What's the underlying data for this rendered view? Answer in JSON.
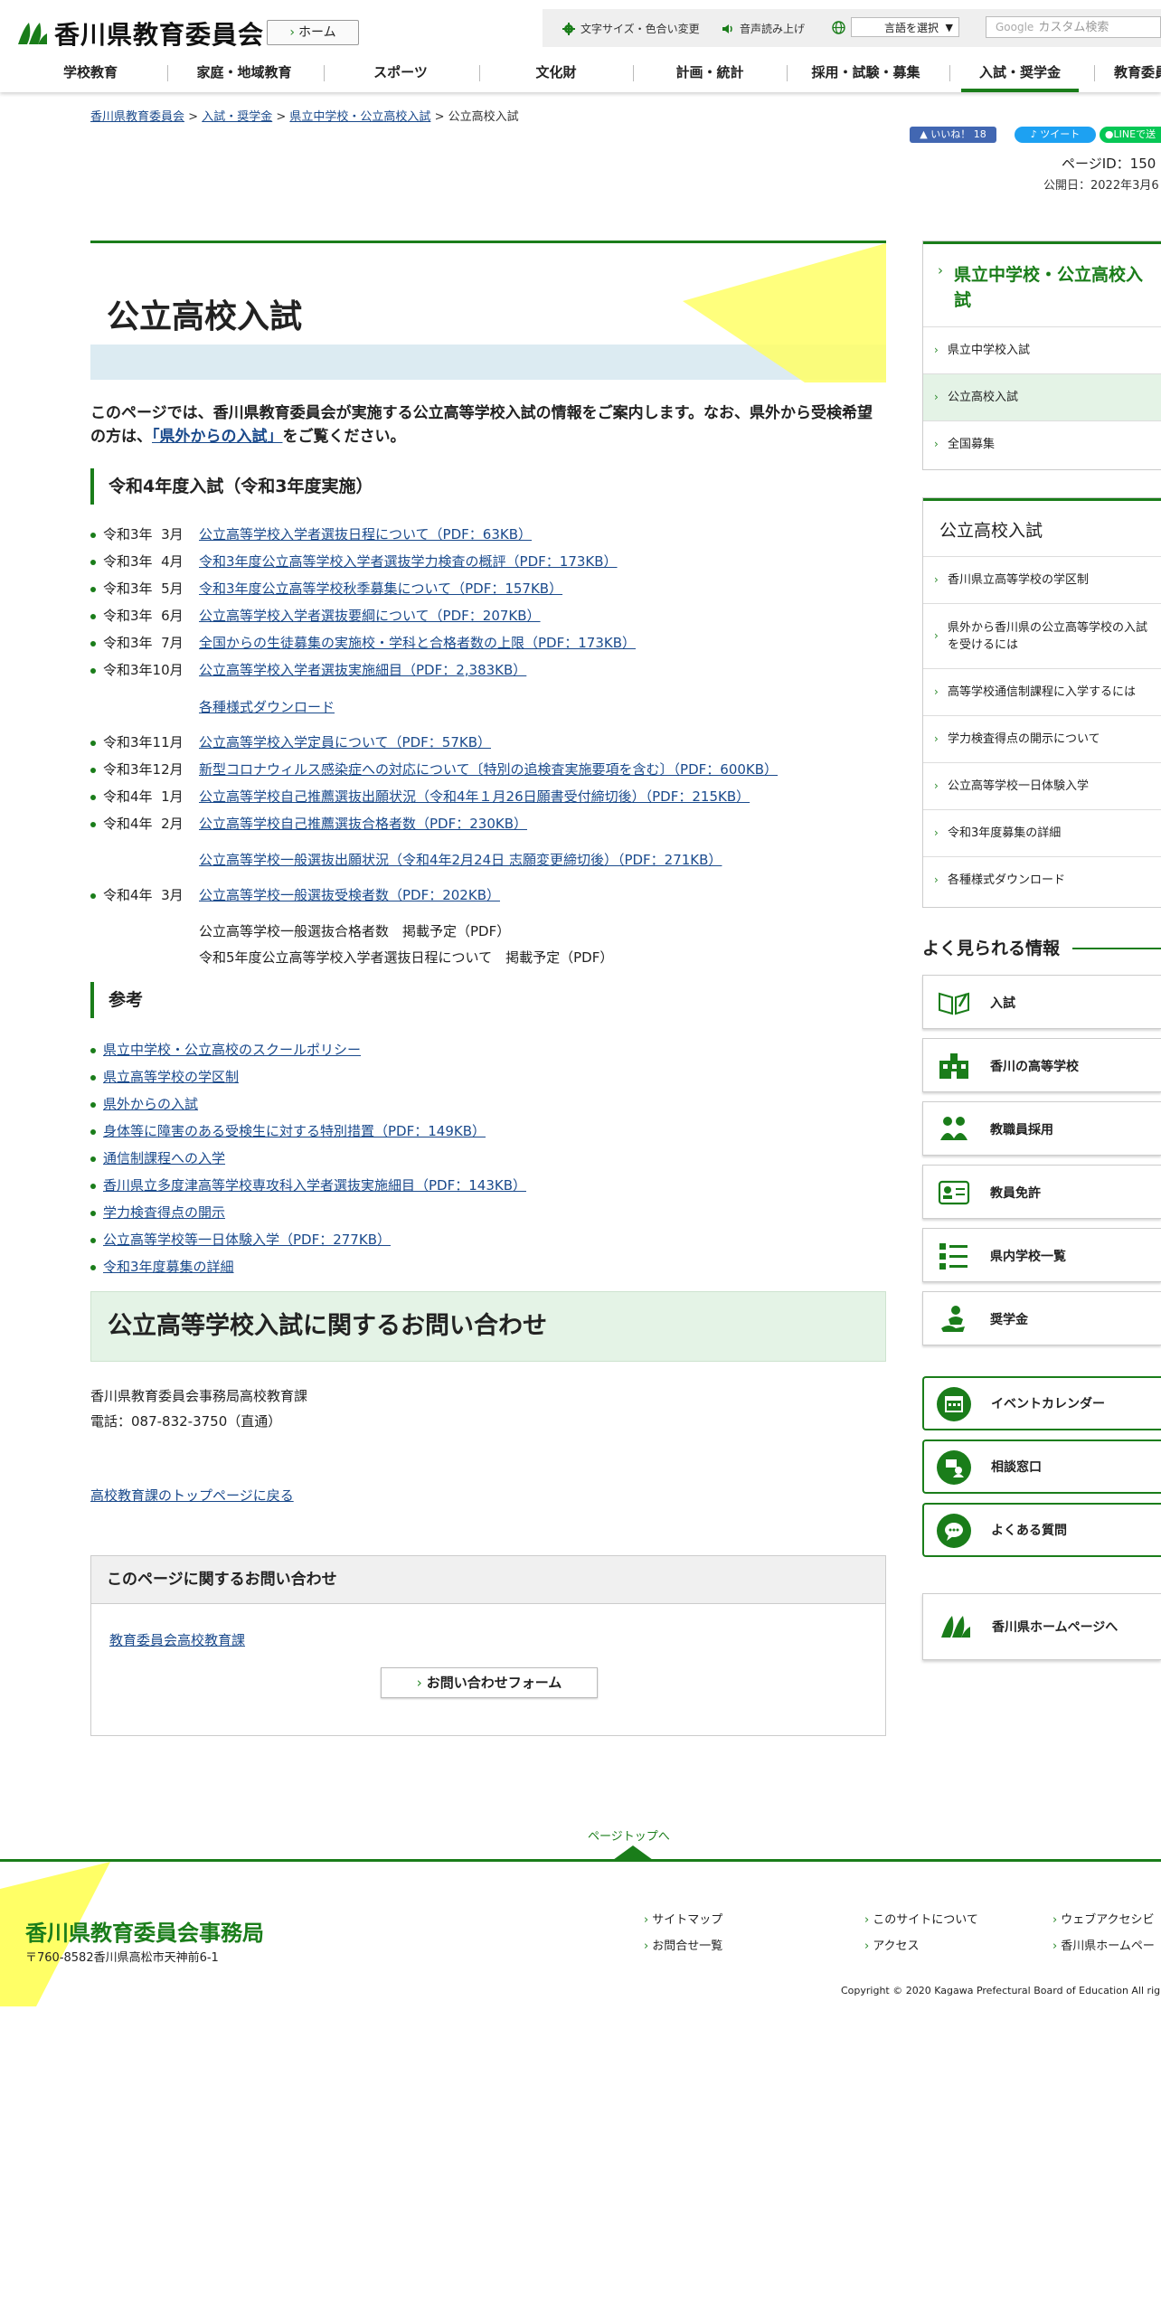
{
  "header": {
    "site_name": "香川県教育委員会",
    "home_label": "ホーム",
    "font_size_label": "文字サイズ・色合い変更",
    "read_aloud_label": "音声読み上げ",
    "language_label": "言語を選択",
    "search_prefix": "Google",
    "search_placeholder": "カスタム検索"
  },
  "nav": [
    "学校教育",
    "家庭・地域教育",
    "スポーツ",
    "文化財",
    "計画・統計",
    "採用・試験・募集",
    "入試・奨学金",
    "教育委員"
  ],
  "breadcrumb": {
    "items": [
      "香川県教育委員会",
      "入試・奨学金",
      "県立中学校・公立高校入試"
    ],
    "sep": ">",
    "current": "公立高校入試"
  },
  "sns": {
    "like": "いいね！ 18",
    "tweet": "ツイート",
    "line": "LINEで送"
  },
  "meta": {
    "page_id": "ページID：150",
    "published": "公開日：2022年3月6"
  },
  "page_title": "公立高校入試",
  "intro": {
    "before": "このページでは、香川県教育委員会が実施する公立高等学校入試の情報をご案内します。なお、県外から受検希望の方は、",
    "link": "「県外からの入試」",
    "after": "をご覧ください。"
  },
  "section1_title": "令和4年度入試（令和3年度実施）",
  "schedule": [
    {
      "date": "令和3年  3月",
      "text": "公立高等学校入学者選抜日程について（PDF：63KB）",
      "link": true
    },
    {
      "date": "令和3年  4月",
      "text": "令和3年度公立高等学校入学者選抜学力検査の概評（PDF：173KB）",
      "link": true
    },
    {
      "date": "令和3年  5月",
      "text": "令和3年度公立高等学校秋季募集について（PDF：157KB）",
      "link": true
    },
    {
      "date": "令和3年  6月",
      "text": "公立高等学校入学者選抜要綱について（PDF：207KB）",
      "link": true
    },
    {
      "date": "令和3年  7月",
      "text": "全国からの生徒募集の実施校・学科と合格者数の上限（PDF：173KB）",
      "link": true
    },
    {
      "date": "令和3年10月",
      "text": "公立高等学校入学者選抜実施細目（PDF：2,383KB）",
      "link": true
    },
    {
      "date": "",
      "text": "各種様式ダウンロード",
      "link": true
    },
    {
      "date": "令和3年11月",
      "text": "公立高等学校入学定員について（PDF：57KB）",
      "link": true
    },
    {
      "date": "令和3年12月",
      "text": "新型コロナウィルス感染症への対応について〔特別の追検査実施要項を含む〕（PDF：600KB）",
      "link": true
    },
    {
      "date": "令和4年  1月",
      "text": "公立高等学校自己推薦選抜出願状況（令和4年１月26日願書受付締切後）（PDF：215KB）",
      "link": true
    },
    {
      "date": "令和4年  2月",
      "text": "公立高等学校自己推薦選抜合格者数（PDF：230KB）",
      "link": true
    },
    {
      "date": "",
      "text": "公立高等学校一般選抜出願状況（令和4年2月24日 志願変更締切後）（PDF：271KB）",
      "link": true
    },
    {
      "date": "令和4年  3月",
      "text": "公立高等学校一般選抜受検者数（PDF：202KB）",
      "link": true
    },
    {
      "date": "",
      "text": "公立高等学校一般選抜合格者数　掲載予定（PDF）",
      "link": false
    },
    {
      "date": "",
      "text": "令和5年度公立高等学校入学者選抜日程について　掲載予定（PDF）",
      "link": false
    }
  ],
  "section2_title": "参考",
  "references": [
    "県立中学校・公立高校のスクールポリシー",
    "県立高等学校の学区制",
    "県外からの入試",
    "身体等に障害のある受検生に対する特別措置（PDF：149KB）",
    "通信制課程への入学",
    "香川県立多度津高等学校専攻科入学者選抜実施細目（PDF：143KB）",
    "学力検査得点の開示",
    "公立高等学校等一日体験入学（PDF：277KB）",
    "令和3年度募集の詳細"
  ],
  "inquiry": {
    "title": "公立高等学校入試に関するお問い合わせ",
    "dept": "香川県教育委員会事務局高校教育課",
    "tel": "電話：087-832-3750（直通）",
    "back": "高校教育課のトップページに戻る"
  },
  "contact": {
    "title": "このページに関するお問い合わせ",
    "dept": "教育委員会高校教育課",
    "form": "お問い合わせフォーム"
  },
  "sidebar": {
    "box1_title": "県立中学校・公立高校入試",
    "box1_items": [
      "県立中学校入試",
      "公立高校入試",
      "全国募集"
    ],
    "box2_title": "公立高校入試",
    "box2_items": [
      "香川県立高等学校の学区制",
      "県外から香川県の公立高等学校の入試を受けるには",
      "高等学校通信制課程に入学するには",
      "学力検査得点の開示について",
      "公立高等学校一日体験入学",
      "令和3年度募集の詳細",
      "各種様式ダウンロード"
    ],
    "popular_title": "よく見られる情報",
    "popular": [
      "入試",
      "香川の高等学校",
      "教職員採用",
      "教員免許",
      "県内学校一覧",
      "奨学金"
    ],
    "utility": [
      "イベントカレンダー",
      "相談窓口",
      "よくある質問"
    ],
    "pref_hp": "香川県ホームページへ"
  },
  "footer": {
    "pagetop": "ページトップへ",
    "org": "香川県教育委員会事務局",
    "address": "〒760-8582香川県高松市天神前6-1",
    "links": [
      "サイトマップ",
      "このサイトについて",
      "ウェブアクセシビ",
      "お問合せ一覧",
      "アクセス",
      "香川県ホームペー"
    ],
    "copyright": "Copyright © 2020 Kagawa Prefectural Board of Education All righ"
  },
  "colors": {
    "accent": "#1a7d1a",
    "link": "#1a4a8c",
    "title_band": "#dcebf2",
    "highlight": "#ffff66",
    "inquiry_bg": "#e4f3e6"
  }
}
